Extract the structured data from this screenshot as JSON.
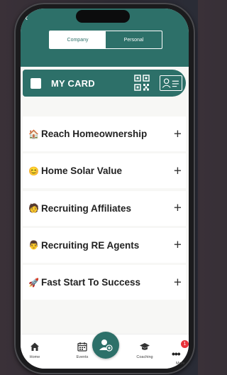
{
  "header": {
    "back_icon": "chevron-left-icon",
    "segments": [
      {
        "label": "Company",
        "active": true
      },
      {
        "label": "Personal",
        "active": false
      }
    ],
    "color": "#2d7069"
  },
  "my_card": {
    "label": "MY CARD",
    "icons": [
      "qr-code-icon",
      "id-card-icon"
    ]
  },
  "list": {
    "items": [
      {
        "emoji": "🏠",
        "label": "Reach Homeownership",
        "action_icon": "plus-icon"
      },
      {
        "emoji": "😊",
        "label": "Home Solar Value",
        "action_icon": "plus-icon"
      },
      {
        "emoji": "🧑",
        "label": "Recruiting Affiliates",
        "action_icon": "plus-icon"
      },
      {
        "emoji": "👨",
        "label": "Recruiting RE Agents",
        "action_icon": "plus-icon"
      },
      {
        "emoji": "🚀",
        "label": "Fast Start To Success",
        "action_icon": "plus-icon"
      }
    ]
  },
  "tabbar": {
    "tabs": [
      {
        "label": "Home",
        "icon": "home-icon"
      },
      {
        "label": "Events",
        "icon": "calendar-icon"
      },
      {
        "label": "Coaching",
        "icon": "graduation-cap-icon"
      },
      {
        "label": "More",
        "icon": "more-dots-icon"
      }
    ],
    "fab_icon": "add-contact-icon",
    "badge": "1"
  }
}
